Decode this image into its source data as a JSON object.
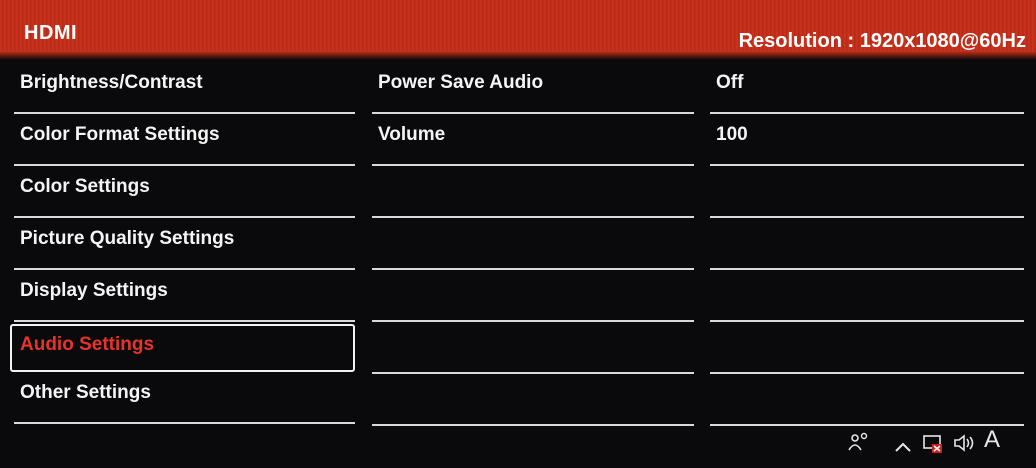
{
  "header": {
    "source": "HDMI",
    "resolution": "Resolution : 1920x1080@60Hz"
  },
  "menu": {
    "items": [
      {
        "label": "Brightness/Contrast"
      },
      {
        "label": "Color Format Settings"
      },
      {
        "label": "Color Settings"
      },
      {
        "label": "Picture Quality Settings"
      },
      {
        "label": "Display Settings"
      },
      {
        "label": "Audio Settings"
      },
      {
        "label": "Other Settings"
      }
    ],
    "selected": "Audio Settings"
  },
  "submenu": {
    "options": [
      {
        "label": "Power Save Audio",
        "value": "Off"
      },
      {
        "label": "Volume",
        "value": "100"
      }
    ]
  },
  "taskbar": {
    "icons": [
      "people-icon",
      "chevron-up-icon",
      "network-icon",
      "speaker-icon",
      "ime-icon"
    ],
    "ime_label": "A"
  },
  "colors": {
    "header_red": "#c8321c",
    "selected_text": "#e8332a",
    "background": "#0a0a0c"
  }
}
